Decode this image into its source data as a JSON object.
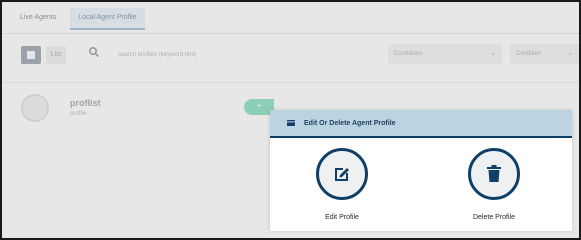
{
  "tabs": [
    {
      "label": "Live Agents",
      "active": false
    },
    {
      "label": "Local Agent Profile",
      "active": true
    }
  ],
  "toolbar": {
    "grid_view_icon": "grid-icon",
    "list_view_label": "List",
    "search_icon": "search-icon",
    "search_placeholder": "search profiles (keyword hint)",
    "filter_select": "Conditions",
    "sort_select": "Condition"
  },
  "agent": {
    "name": "proflist",
    "subtitle": "profile",
    "button_label": "+"
  },
  "popup": {
    "title": "Edit Or Delete Agent Profile",
    "header_icon": "card-icon",
    "actions": [
      {
        "label": "Edit Profile",
        "icon": "edit-icon"
      },
      {
        "label": "Delete Profile",
        "icon": "trash-icon"
      }
    ]
  },
  "colors": {
    "accent": "#0f3f66",
    "header_bg": "#bcd3e3",
    "success": "#8ccfb6"
  }
}
